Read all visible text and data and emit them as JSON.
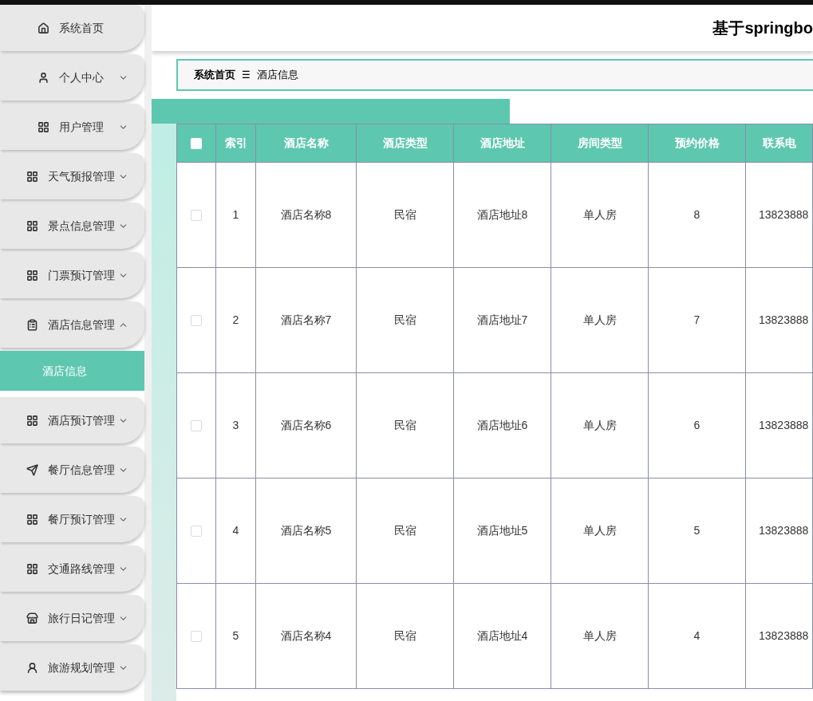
{
  "header": {
    "title": "基于springbo"
  },
  "sidebar": {
    "items": [
      {
        "label": "系统首页"
      },
      {
        "label": "个人中心",
        "expanded": false
      },
      {
        "label": "用户管理",
        "expanded": false
      },
      {
        "label": "天气预报管理",
        "expanded": false
      },
      {
        "label": "景点信息管理",
        "expanded": false
      },
      {
        "label": "门票预订管理",
        "expanded": false
      },
      {
        "label": "酒店信息管理",
        "expanded": true,
        "children": [
          {
            "label": "酒店信息",
            "selected": true
          }
        ]
      },
      {
        "label": "酒店预订管理",
        "expanded": false
      },
      {
        "label": "餐厅信息管理",
        "expanded": false
      },
      {
        "label": "餐厅预订管理",
        "expanded": false
      },
      {
        "label": "交通路线管理",
        "expanded": false
      },
      {
        "label": "旅行日记管理",
        "expanded": false
      },
      {
        "label": "旅游规划管理",
        "expanded": false
      }
    ]
  },
  "breadcrumb": {
    "items": [
      "系统首页",
      "酒店信息"
    ],
    "separator": "☰"
  },
  "table": {
    "header_checkbox": {
      "checked": false
    },
    "columns": [
      "索引",
      "酒店名称",
      "酒店类型",
      "酒店地址",
      "房间类型",
      "预约价格",
      "联系电"
    ],
    "rows": [
      {
        "selected": false,
        "cells": [
          "1",
          "酒店名称8",
          "民宿",
          "酒店地址8",
          "单人房",
          "8",
          "13823888"
        ]
      },
      {
        "selected": false,
        "cells": [
          "2",
          "酒店名称7",
          "民宿",
          "酒店地址7",
          "单人房",
          "7",
          "13823888"
        ]
      },
      {
        "selected": false,
        "cells": [
          "3",
          "酒店名称6",
          "民宿",
          "酒店地址6",
          "单人房",
          "6",
          "13823888"
        ]
      },
      {
        "selected": false,
        "cells": [
          "4",
          "酒店名称5",
          "民宿",
          "酒店地址5",
          "单人房",
          "5",
          "13823888"
        ]
      },
      {
        "selected": false,
        "cells": [
          "5",
          "酒店名称4",
          "民宿",
          "酒店地址4",
          "单人房",
          "4",
          "13823888"
        ]
      }
    ]
  }
}
